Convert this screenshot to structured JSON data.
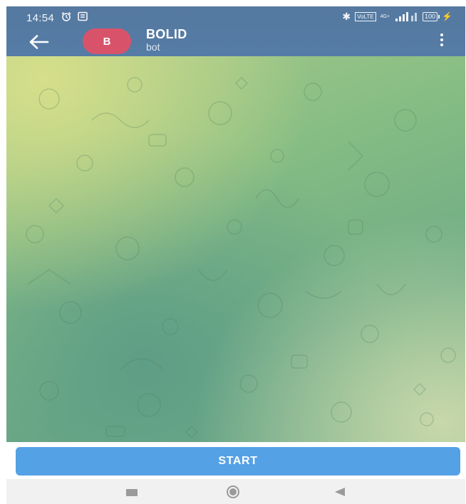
{
  "status_bar": {
    "time": "14:54",
    "net_tag": "4G+",
    "battery": "100"
  },
  "header": {
    "avatar_letter": "B",
    "title": "BOLID",
    "subtitle": "bot",
    "avatar_color": "#d8536a",
    "bar_color": "#557ca6"
  },
  "bottom": {
    "start_label": "START",
    "button_color": "#55a1e6"
  },
  "nav": {
    "icons": [
      "recent-apps-icon",
      "home-icon",
      "back-icon"
    ]
  }
}
